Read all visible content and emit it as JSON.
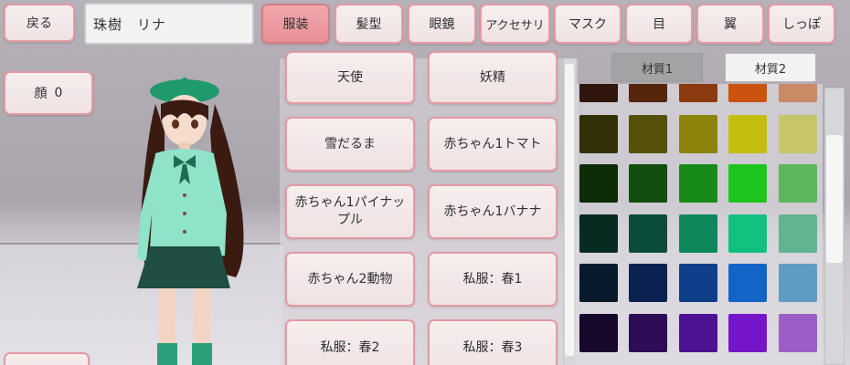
{
  "top_bar": {
    "back_label": "戻る",
    "character_name": "珠樹　リナ",
    "tabs": [
      {
        "label": "服装",
        "selected": true
      },
      {
        "label": "髪型",
        "selected": false
      },
      {
        "label": "眼鏡",
        "selected": false
      },
      {
        "label": "アクセサリ",
        "selected": false
      },
      {
        "label": "マスク",
        "selected": false
      },
      {
        "label": "目",
        "selected": false
      },
      {
        "label": "翼",
        "selected": false
      },
      {
        "label": "しっぽ",
        "selected": false
      }
    ]
  },
  "face": {
    "label": "顔",
    "value": "0"
  },
  "outfit_list": [
    [
      "天使",
      "妖精"
    ],
    [
      "雪だるま",
      "赤ちゃん1トマト"
    ],
    [
      "赤ちゃん1パイナップル",
      "赤ちゃん1バナナ"
    ],
    [
      "赤ちゃん2動物",
      "私服：春1"
    ],
    [
      "私服：春2",
      "私服：春3"
    ]
  ],
  "material_tabs": {
    "active": "材質1",
    "inactive": "材質2"
  },
  "palette_colors": [
    [
      "#2f160d",
      "#55260a",
      "#8c3a10",
      "#c9530f",
      "#c98a66"
    ],
    [
      "#333007",
      "#555109",
      "#8b830a",
      "#c3be0c",
      "#c7c56a"
    ],
    [
      "#0f2c08",
      "#114e0c",
      "#178a18",
      "#1fc51f",
      "#5cb65c"
    ],
    [
      "#072b21",
      "#0a4c3b",
      "#0e875b",
      "#12c07d",
      "#5fb48f"
    ],
    [
      "#0a1a2d",
      "#0b2150",
      "#0f3f8a",
      "#1463c7",
      "#5f9cc4"
    ],
    [
      "#17082c",
      "#2d0b55",
      "#4c1293",
      "#7515c9",
      "#9a5ec6"
    ]
  ]
}
